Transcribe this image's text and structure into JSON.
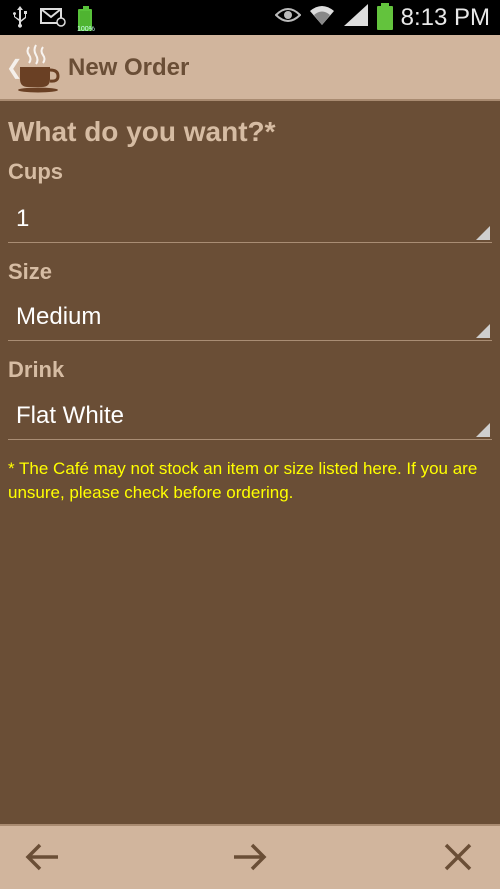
{
  "status_bar": {
    "time": "8:13 PM",
    "battery_small_text": "100%",
    "icons": [
      "usb-icon",
      "email-notification-icon",
      "battery-icon",
      "eye-icon",
      "wifi-icon",
      "signal-icon",
      "battery-icon"
    ]
  },
  "action_bar": {
    "title": "New Order",
    "icon": "coffee-cup-icon"
  },
  "form": {
    "question": "What do you want?*",
    "cups": {
      "label": "Cups",
      "value": "1"
    },
    "size": {
      "label": "Size",
      "value": "Medium"
    },
    "drink": {
      "label": "Drink",
      "value": "Flat White"
    },
    "footnote": "* The Café may not stock an item or size listed here. If you are unsure, please check before ordering."
  },
  "bottom_bar": {
    "icons": [
      "back-arrow-icon",
      "forward-arrow-icon",
      "close-icon"
    ]
  },
  "colors": {
    "background": "#6a4e36",
    "bar": "#d1b59d",
    "label": "#d6bca3",
    "footnote": "#ffff00"
  }
}
